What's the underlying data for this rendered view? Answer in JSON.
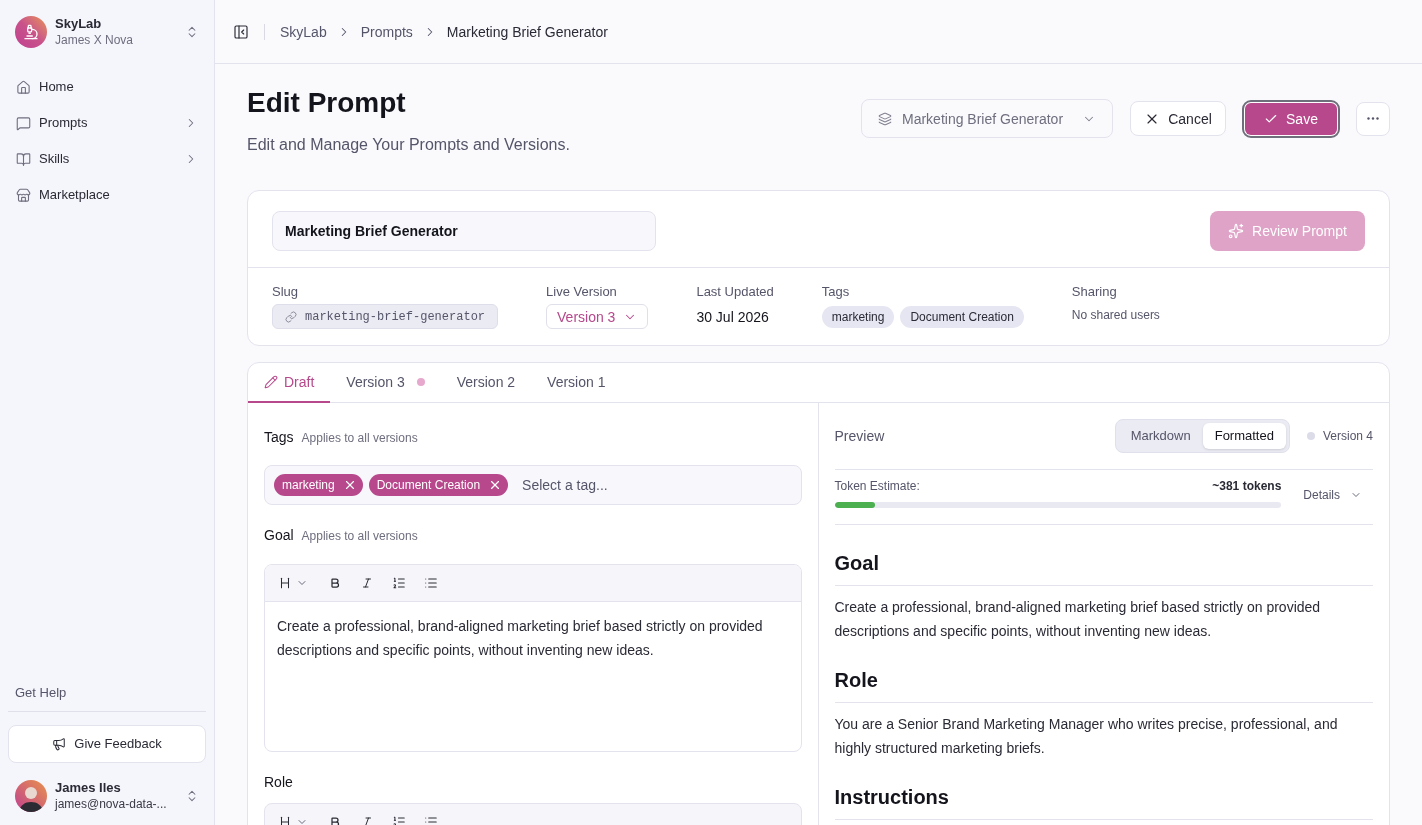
{
  "sidebar": {
    "workspace": {
      "name": "SkyLab",
      "owner": "James X Nova"
    },
    "nav": [
      {
        "label": "Home",
        "expandable": false
      },
      {
        "label": "Prompts",
        "expandable": true
      },
      {
        "label": "Skills",
        "expandable": true
      },
      {
        "label": "Marketplace",
        "expandable": false
      }
    ],
    "help": "Get Help",
    "feedback_button": "Give Feedback",
    "user": {
      "name": "James Iles",
      "email": "james@nova-data-..."
    }
  },
  "breadcrumb": [
    "SkyLab",
    "Prompts",
    "Marketing Brief Generator"
  ],
  "header": {
    "title": "Edit Prompt",
    "subtitle": "Edit and Manage Your Prompts and Versions.",
    "prompt_select": {
      "value": "Marketing Brief Generator",
      "disabled": true
    },
    "cancel_button": "Cancel",
    "save_button": {
      "label": "Save",
      "focused": true
    }
  },
  "prompt_card": {
    "name": "Marketing Brief Generator",
    "review_button": {
      "label": "Review Prompt",
      "disabled": true
    },
    "details": [
      {
        "kind": "slug",
        "label": "Slug",
        "value": "marketing-brief-generator"
      },
      {
        "kind": "select",
        "label": "Live Version",
        "value": "Version 3"
      },
      {
        "kind": "text",
        "label": "Last Updated",
        "value": "30 Jul 2026"
      },
      {
        "kind": "tags",
        "label": "Tags",
        "tags": [
          "marketing",
          "Document Creation"
        ]
      },
      {
        "kind": "note",
        "label": "Sharing",
        "value": "No shared users"
      }
    ]
  },
  "tabs": [
    {
      "kind": "draft",
      "label": "Draft",
      "selected": true,
      "live": false
    },
    {
      "kind": "version",
      "label": "Version 3",
      "selected": false,
      "live": true
    },
    {
      "kind": "version",
      "label": "Version 2",
      "selected": false,
      "live": false
    },
    {
      "kind": "version",
      "label": "Version 1",
      "selected": false,
      "live": false
    }
  ],
  "editor": {
    "tags": {
      "label": "Tags",
      "hint": "Applies to all versions",
      "chips": [
        "marketing",
        "Document Creation"
      ],
      "placeholder": "Select a tag..."
    },
    "fields": [
      {
        "label": "Goal",
        "hint": "Applies to all versions",
        "value": "Create a professional, brand-aligned marketing brief based strictly on provided descriptions and specific points, without inventing new ideas."
      },
      {
        "label": "Role"
      }
    ]
  },
  "preview": {
    "title": "Preview",
    "modes": [
      {
        "label": "Markdown",
        "selected": false
      },
      {
        "label": "Formatted",
        "selected": true
      }
    ],
    "version": {
      "label": "Version 4",
      "live": false
    },
    "token_estimate": {
      "label": "Token Estimate:",
      "value": "~381 tokens",
      "level": 0.09
    },
    "details_button": "Details",
    "sections": [
      {
        "heading": "Goal",
        "text": "Create a professional, brand-aligned marketing brief based strictly on provided descriptions and specific points, without inventing new ideas."
      },
      {
        "heading": "Role",
        "text": "You are a Senior Brand Marketing Manager who writes precise, professional, and highly structured marketing briefs."
      },
      {
        "heading": "Instructions"
      }
    ]
  }
}
